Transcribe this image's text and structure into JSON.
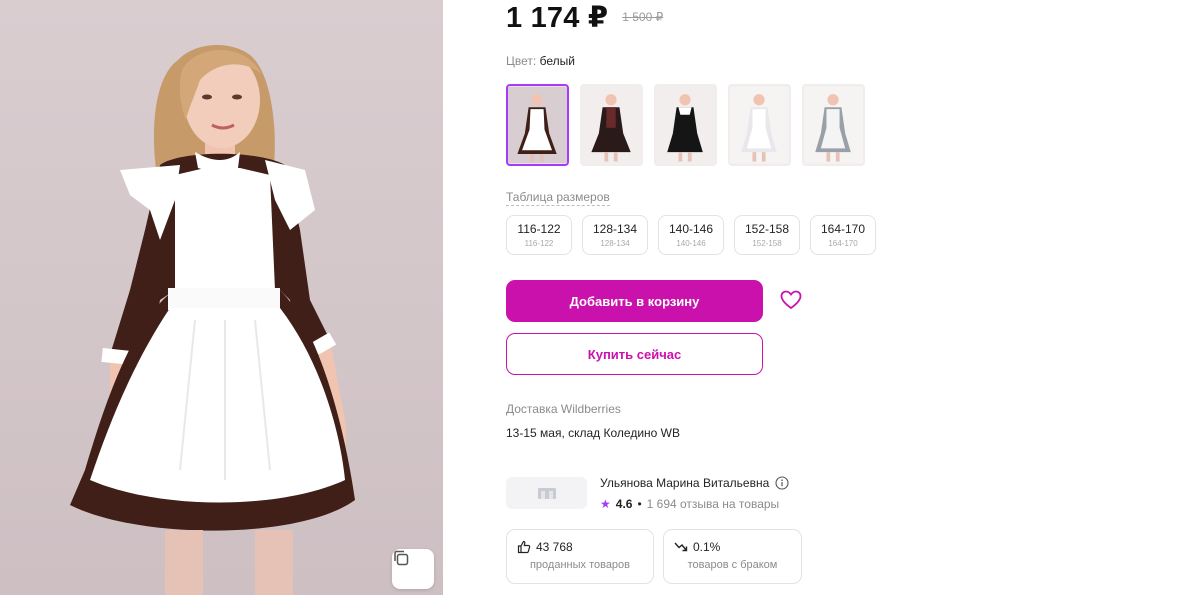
{
  "product": {
    "price": "1 174 ₽",
    "old_price": "1 500 ₽"
  },
  "color": {
    "label": "Цвет:",
    "value": "белый",
    "thumbnails": [
      {
        "name": "brown-white-apron",
        "selected": true
      },
      {
        "name": "dark-dress-2",
        "selected": false
      },
      {
        "name": "dark-dress-3",
        "selected": false
      },
      {
        "name": "white-dress-4",
        "selected": false
      },
      {
        "name": "grey-dress-5",
        "selected": false
      }
    ]
  },
  "sizes": {
    "table_link": "Таблица размеров",
    "options": [
      {
        "main": "116-122",
        "sub": "116-122"
      },
      {
        "main": "128-134",
        "sub": "128-134"
      },
      {
        "main": "140-146",
        "sub": "140-146"
      },
      {
        "main": "152-158",
        "sub": "152-158"
      },
      {
        "main": "164-170",
        "sub": "164-170"
      }
    ]
  },
  "actions": {
    "add_to_cart": "Добавить в корзину",
    "buy_now": "Купить сейчас"
  },
  "delivery": {
    "title": "Доставка Wildberries",
    "info": "13-15 мая, склад Коледино WB"
  },
  "seller": {
    "name": "Ульянова Марина Витальевна",
    "rating": "4.6",
    "reviews": "1 694 отзыва на товары"
  },
  "stats": {
    "sold_value": "43 768",
    "sold_label": "проданных товаров",
    "defect_value": "0.1%",
    "defect_label": "товаров с браком"
  },
  "colors": {
    "accent": "#cb11ab",
    "thumb_selected": "#a73afd",
    "dress_brown": "#3f1f17",
    "apron_white": "#ffffff"
  }
}
